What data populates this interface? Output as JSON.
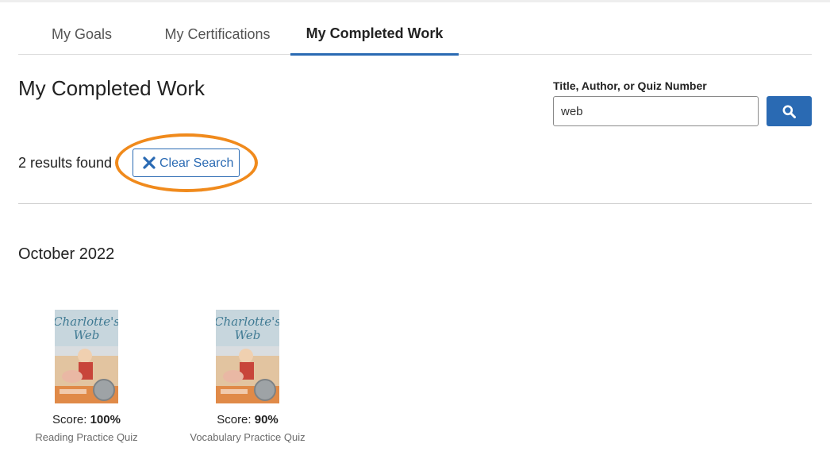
{
  "tabs": [
    {
      "label": "My Goals",
      "active": false
    },
    {
      "label": "My Certifications",
      "active": false
    },
    {
      "label": "My Completed Work",
      "active": true
    }
  ],
  "page_title": "My Completed Work",
  "search": {
    "label": "Title, Author, or Quiz Number",
    "value": "web",
    "button_icon": "search-icon"
  },
  "results_text": "2 results found",
  "clear_search_label": "Clear Search",
  "month_heading": "October 2022",
  "items": [
    {
      "score_label": "Score:",
      "score_value": "100%",
      "quiz_type": "Reading Practice Quiz"
    },
    {
      "score_label": "Score:",
      "score_value": "90%",
      "quiz_type": "Vocabulary Practice Quiz"
    }
  ],
  "colors": {
    "accent": "#2a6ab3",
    "highlight": "#f08a1c"
  }
}
